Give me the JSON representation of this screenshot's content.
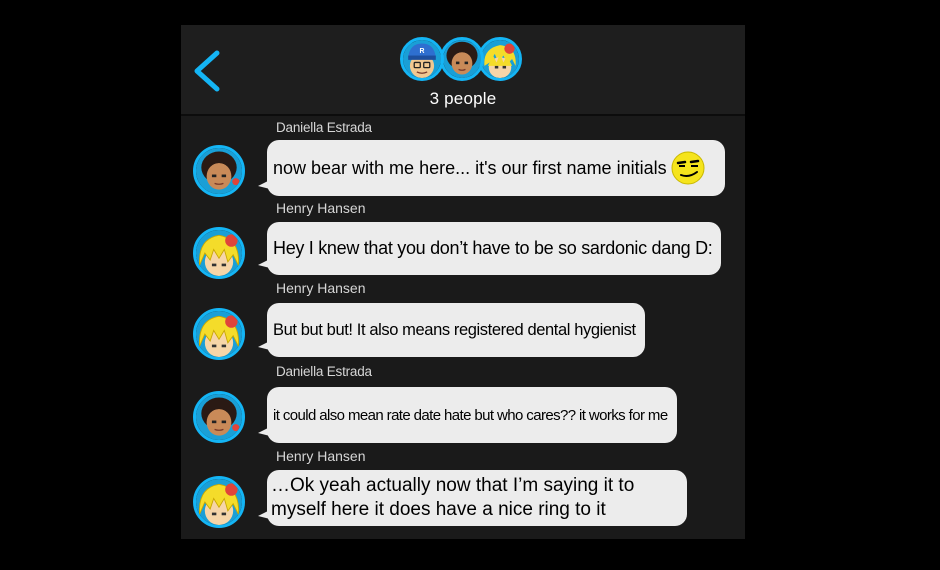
{
  "header": {
    "back_icon": "chevron-left-icon",
    "people_count": "3 people",
    "accent_color": "#14b5f5"
  },
  "messages": [
    {
      "sender": "Daniella Estrada",
      "avatar": "girl-avatar-icon",
      "text": "now bear with me here... it's our first name initials",
      "emoji": "smirk-emoji-icon"
    },
    {
      "sender": "Henry Hansen",
      "avatar": "blond-boy-avatar-icon",
      "text": "Hey I knew that you don’t have to be so sardonic dang D:"
    },
    {
      "sender": "Henry Hansen",
      "avatar": "blond-boy-avatar-icon",
      "text": "But but but! It also means registered dental hygienist"
    },
    {
      "sender": "Daniella Estrada",
      "avatar": "girl-avatar-icon",
      "text": "it could also mean rate date hate but who cares?? it works for me"
    },
    {
      "sender": "Henry Hansen",
      "avatar": "blond-boy-avatar-icon",
      "text": "…Ok yeah actually now that I’m saying it to myself here it does have a nice ring to it"
    }
  ]
}
